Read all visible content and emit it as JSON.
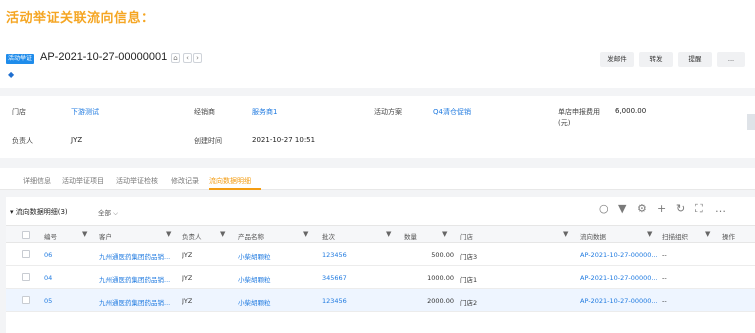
{
  "caption": "活动举证关联流向信息：",
  "header": {
    "tag": "活动举证",
    "doc_no": "AP-2021-10-27-00000001",
    "buttons": [
      "发邮件",
      "转发",
      "提醒",
      "..."
    ]
  },
  "info": {
    "store_label": "门店",
    "store_value": "下游测试",
    "distributor_label": "经销商",
    "distributor_value": "服务商1",
    "plan_label": "活动方案",
    "plan_value": "Q4清仓促销",
    "fee_label_1": "单店申报费用",
    "fee_label_2": "(元)",
    "fee_value": "6,000.00",
    "owner_label": "负责人",
    "owner_value": "JYZ",
    "created_label": "创建时间",
    "created_value": "2021-10-27 10:51"
  },
  "tabs": [
    "详细信息",
    "活动举证项目",
    "活动举证检核",
    "修改记录",
    "流向数据明细"
  ],
  "grid": {
    "title": "流向数据明细(3)",
    "filter": "全部",
    "columns": [
      "编号",
      "客户",
      "负责人",
      "产品名称",
      "批次",
      "数量",
      "门店",
      "流向数据",
      "扫描组织",
      "操作"
    ],
    "rows": [
      {
        "no": "06",
        "customer": "九州通医药集团药品销...",
        "owner": "JYZ",
        "product": "小柴胡颗粒",
        "batch": "123456",
        "qty": "500.00",
        "store": "门店3",
        "flow": "AP-2021-10-27-00000...",
        "org": "--"
      },
      {
        "no": "04",
        "customer": "九州通医药集团药品销...",
        "owner": "JYZ",
        "product": "小柴胡颗粒",
        "batch": "345667",
        "qty": "1000.00",
        "store": "门店1",
        "flow": "AP-2021-10-27-00000...",
        "org": "--"
      },
      {
        "no": "05",
        "customer": "九州通医药集团药品销...",
        "owner": "JYZ",
        "product": "小柴胡颗粒",
        "batch": "123456",
        "qty": "2000.00",
        "store": "门店2",
        "flow": "AP-2021-10-27-00000...",
        "org": "--"
      }
    ]
  },
  "colors": {
    "accent": "#f39c12",
    "link": "#1f7ae0",
    "caption": "#f5a623"
  }
}
